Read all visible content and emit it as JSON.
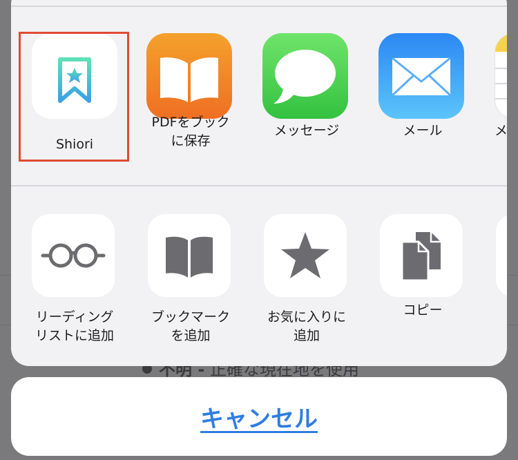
{
  "background": {
    "partial_text_bold": "不明 -",
    "partial_text": "正確な現在地を使用"
  },
  "apps": [
    {
      "label": "Shiori",
      "icon": "shiori-bookmark-icon"
    },
    {
      "label": "PDFをブック\nに保存",
      "icon": "books-icon"
    },
    {
      "label": "メッセージ",
      "icon": "messages-icon"
    },
    {
      "label": "メール",
      "icon": "mail-icon"
    },
    {
      "label": "メ",
      "icon": "notes-icon"
    }
  ],
  "actions": [
    {
      "label": "リーディング\nリストに追加",
      "icon": "glasses-icon"
    },
    {
      "label": "ブックマーク\nを追加",
      "icon": "book-icon"
    },
    {
      "label": "お気に入りに\n追加",
      "icon": "star-icon"
    },
    {
      "label": "コピー",
      "icon": "copy-icon"
    }
  ],
  "cancel_label": "キャンセル",
  "colors": {
    "highlight": "#e04a33",
    "cancel_text": "#2f7de1",
    "action_icon": "#6b6b70"
  }
}
